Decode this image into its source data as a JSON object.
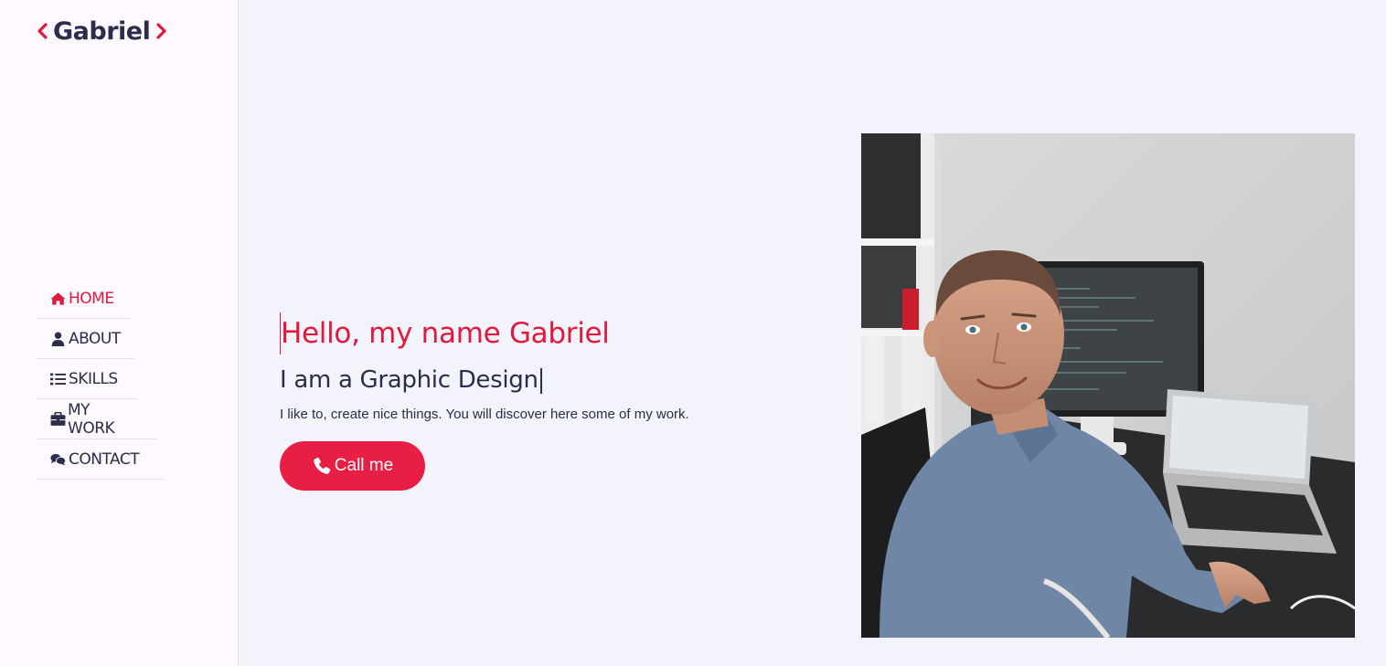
{
  "brand": {
    "name": "Gabriel",
    "accent": "#e0193f",
    "text_color": "#2b2e4a"
  },
  "nav": {
    "items": [
      {
        "label": "HOME",
        "icon": "home-icon",
        "active": true
      },
      {
        "label": "ABOUT",
        "icon": "user-icon",
        "active": false
      },
      {
        "label": "SKILLS",
        "icon": "list-icon",
        "active": false
      },
      {
        "label": "MY WORK",
        "icon": "briefcase-icon",
        "active": false
      },
      {
        "label": "CONTACT",
        "icon": "comments-icon",
        "active": false
      }
    ]
  },
  "hero": {
    "greeting": "Hello, my name Gabriel",
    "role": "I am a Graphic Design",
    "tagline": "I like to, create nice things. You will discover here some of my work.",
    "call_button": "Call me"
  },
  "photo": {
    "subject": "portrait photo of man at desk with monitor and laptop"
  }
}
